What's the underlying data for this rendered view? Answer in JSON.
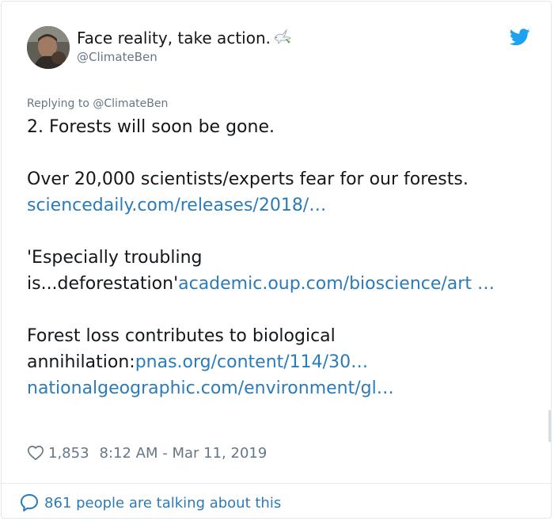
{
  "tweet": {
    "display_name": "Face reality, take action.",
    "handle": "@ClimateBen",
    "replying_to": "Replying to @ClimateBen",
    "icons": {
      "dove": "dove-emoji-icon",
      "brand": "twitter-bird-icon",
      "like": "heart-outline-icon",
      "reply": "speech-bubble-icon"
    },
    "paragraphs": {
      "p1": "2. Forests will soon be gone.",
      "p2_text": "Over 20,000 scientists/experts fear for our forests.",
      "p2_link": "sciencedaily.com/releases/2018/…",
      "p3_text": "'Especially troubling is...deforestation'",
      "p3_link": "academic.oup.com/bioscience/art …",
      "p4_text": "Forest loss contributes to biological annihilation:",
      "p4_link1": "pnas.org/content/114/30…",
      "p4_link2": "nationalgeographic.com/environment/gl…"
    },
    "likes": "1,853",
    "timestamp": "8:12 AM - Mar 11, 2019",
    "talking": "861 people are talking about this"
  },
  "colors": {
    "link": "#2b7bb9",
    "text": "#14171a",
    "muted": "#657786",
    "twitter_blue": "#1da1f2",
    "border": "#e1e8ed"
  }
}
